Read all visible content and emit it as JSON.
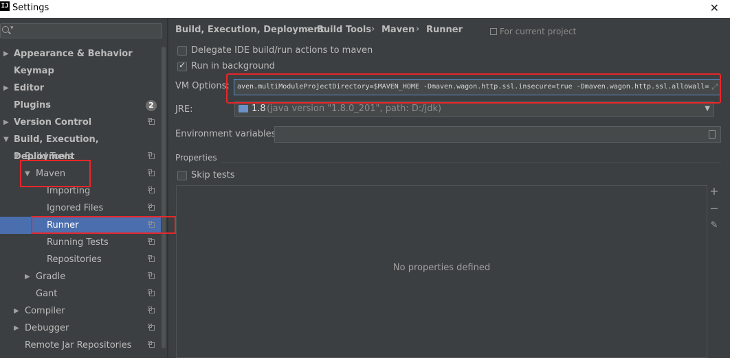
{
  "window": {
    "title": "Settings",
    "app_icon_text": "IJ",
    "close_glyph": "✕"
  },
  "sidebar": {
    "search": {
      "placeholder": ""
    },
    "items": [
      {
        "label": "Appearance & Behavior",
        "arrow": "▶",
        "bold": true
      },
      {
        "label": "Keymap",
        "bold": true
      },
      {
        "label": "Editor",
        "arrow": "▶",
        "bold": true
      },
      {
        "label": "Plugins",
        "bold": true,
        "badge": "2"
      },
      {
        "label": "Version Control",
        "arrow": "▶",
        "bold": true
      },
      {
        "label": "Build, Execution, Deployment",
        "arrow": "▼",
        "bold": true
      },
      {
        "label": "Build Tools",
        "arrow": "▼"
      },
      {
        "label": "Maven",
        "arrow": "▼"
      },
      {
        "label": "Importing"
      },
      {
        "label": "Ignored Files"
      },
      {
        "label": "Runner",
        "selected": true
      },
      {
        "label": "Running Tests"
      },
      {
        "label": "Repositories"
      },
      {
        "label": "Gradle",
        "arrow": "▶"
      },
      {
        "label": "Gant"
      },
      {
        "label": "Compiler",
        "arrow": "▶"
      },
      {
        "label": "Debugger",
        "arrow": "▶"
      },
      {
        "label": "Remote Jar Repositories"
      }
    ]
  },
  "breadcrumb": {
    "items": [
      "Build, Execution, Deployment",
      "Build Tools",
      "Maven",
      "Runner"
    ],
    "separator": "›",
    "scope": "For current project"
  },
  "form": {
    "delegate_label": "Delegate IDE build/run actions to maven",
    "delegate_checked": false,
    "background_label": "Run in background",
    "background_checked": true,
    "vm_options_label": "VM Options:",
    "vm_options_value": "aven.multiModuleProjectDirectory=$MAVEN_HOME -Dmaven.wagon.http.ssl.insecure=true -Dmaven.wagon.http.ssl.allowall=",
    "jre_label": "JRE:",
    "jre_version": "1.8",
    "jre_details": "(java version \"1.8.0_201\", path: D:/jdk)",
    "env_label": "Environment variables:",
    "env_value": "",
    "properties_label": "Properties",
    "skip_tests_label": "Skip tests",
    "skip_tests_checked": false,
    "no_properties_text": "No properties defined"
  },
  "colors": {
    "highlight_box": "#e8262a",
    "selection": "#4b6eaf",
    "background": "#3c3f41"
  }
}
